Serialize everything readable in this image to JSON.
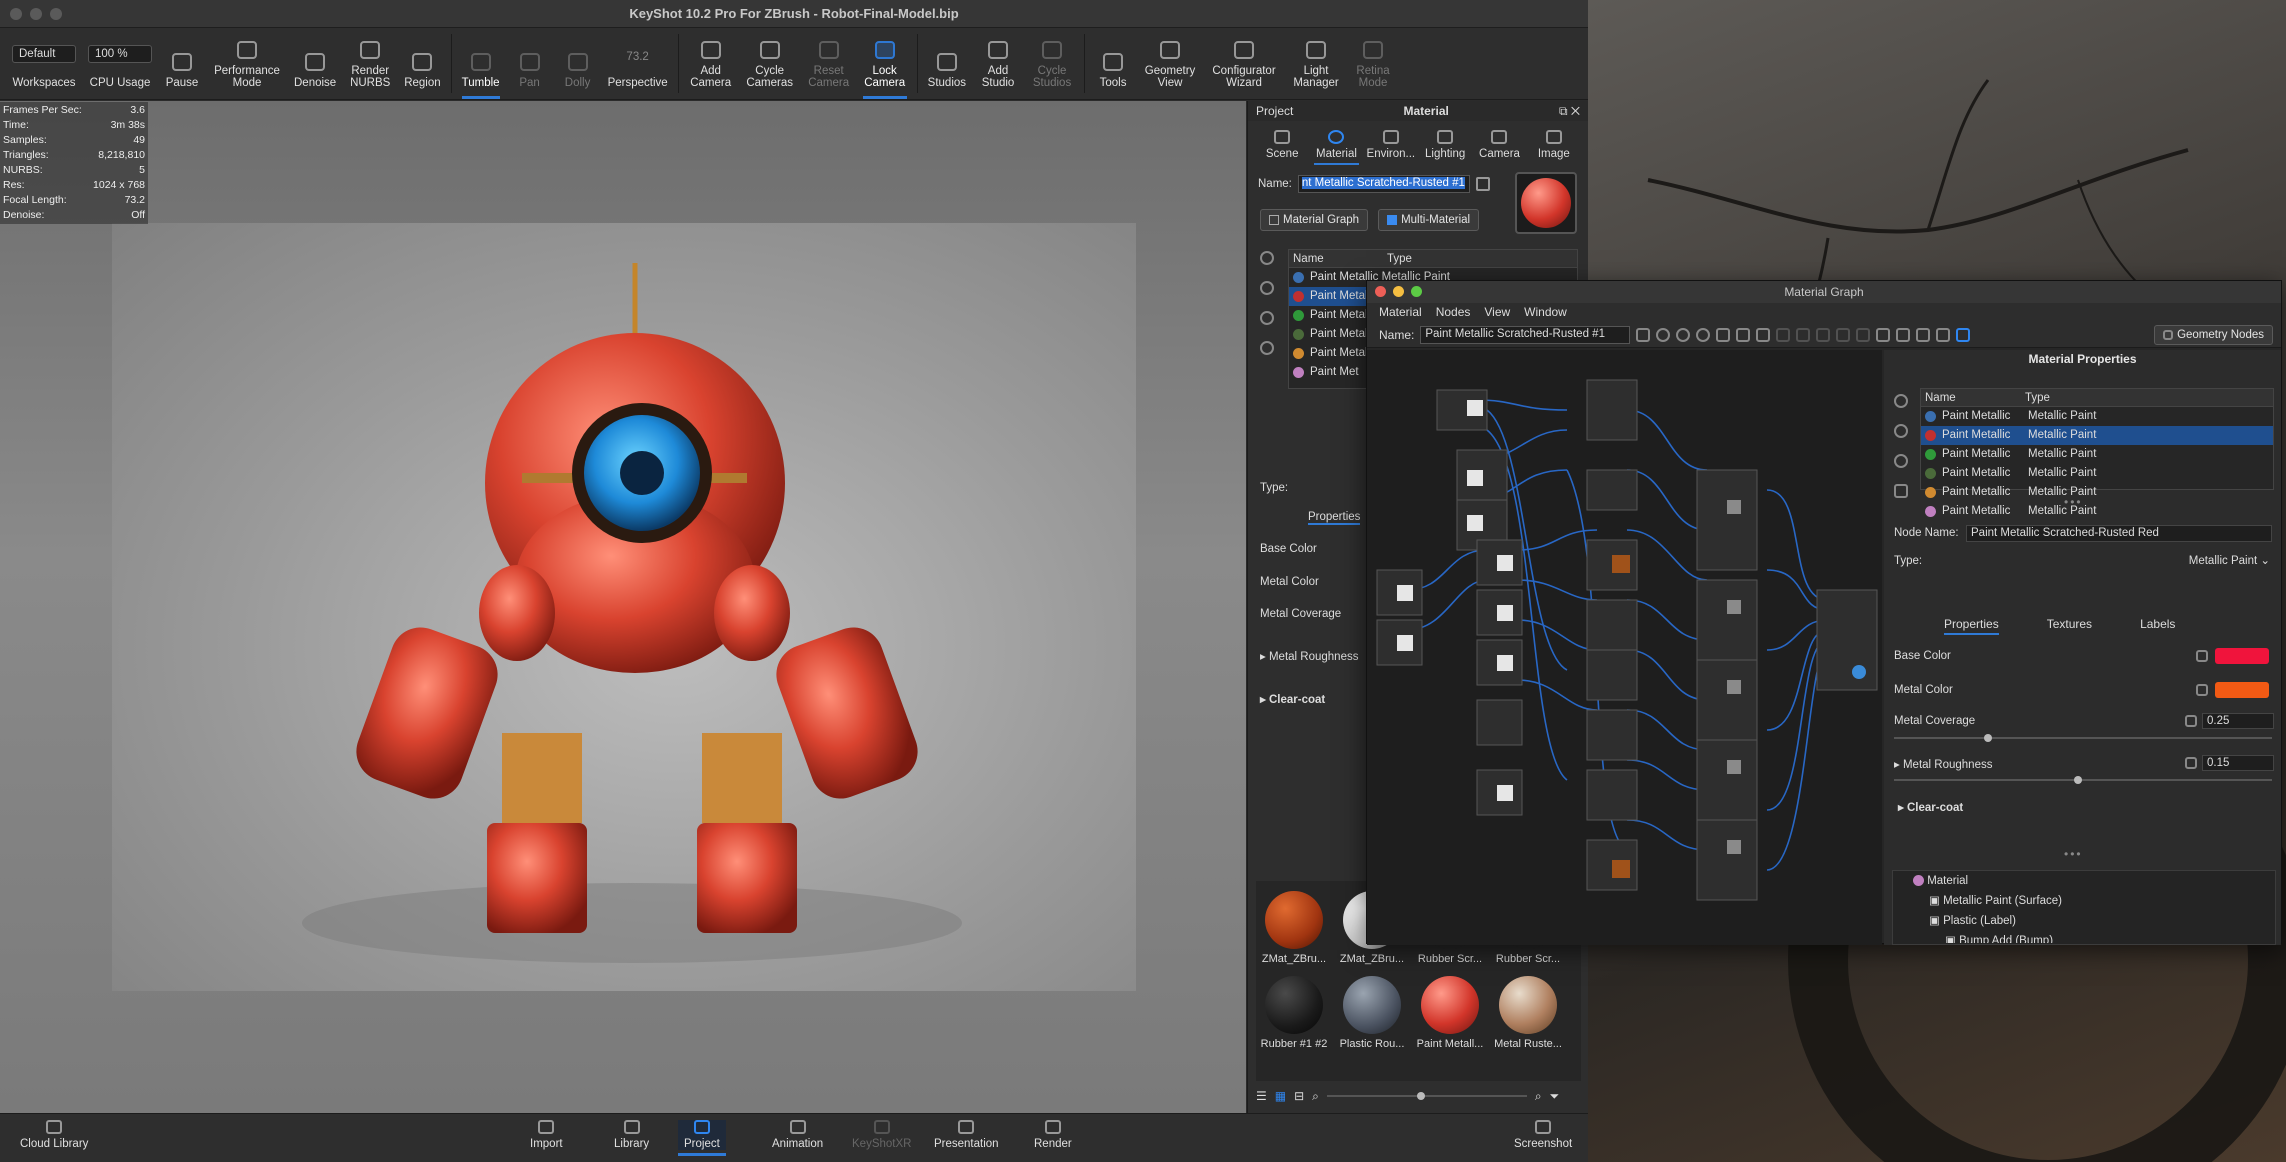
{
  "window": {
    "title": "KeyShot 10.2 Pro For ZBrush - Robot-Final-Model.bip"
  },
  "toolbar": {
    "workspace_value": "Default",
    "workspaces_label": "Workspaces",
    "cpu_value": "100 %",
    "cpu_label": "CPU Usage",
    "pause_label": "Pause",
    "performance_label": "Performance Mode",
    "denoise_label": "Denoise",
    "render_nurbs_label": "Render NURBS",
    "region_label": "Region",
    "tumble_label": "Tumble",
    "pan_label": "Pan",
    "dolly_label": "Dolly",
    "fov_value": "73.2",
    "perspective_label": "Perspective",
    "add_camera_label": "Add Camera",
    "cycle_cameras_label": "Cycle Cameras",
    "reset_camera_label": "Reset Camera",
    "lock_camera_label": "Lock Camera",
    "studios_label": "Studios",
    "add_studio_label": "Add Studio",
    "cycle_studios_label": "Cycle Studios",
    "tools_label": "Tools",
    "geometry_view_label": "Geometry View",
    "configurator_label": "Configurator Wizard",
    "light_manager_label": "Light Manager",
    "retina_label": "Retina Mode"
  },
  "stats": [
    {
      "k": "Frames Per Sec:",
      "v": "3.6"
    },
    {
      "k": "Time:",
      "v": "3m 38s"
    },
    {
      "k": "Samples:",
      "v": "49"
    },
    {
      "k": "Triangles:",
      "v": "8,218,810"
    },
    {
      "k": "NURBS:",
      "v": "5"
    },
    {
      "k": "Res:",
      "v": "1024 x 768"
    },
    {
      "k": "Focal Length:",
      "v": "73.2"
    },
    {
      "k": "Denoise:",
      "v": "Off"
    }
  ],
  "panel": {
    "tab_project": "Project",
    "tab_material": "Material",
    "tabs": [
      "Scene",
      "Material",
      "Environ...",
      "Lighting",
      "Camera",
      "Image"
    ],
    "name_label": "Name:",
    "name_value": "nt Metallic Scratched-Rusted #1",
    "material_graph_btn": "Material Graph",
    "multi_material_btn": "Multi-Material",
    "list_col_name": "Name",
    "list_col_type": "Type",
    "list_rows": [
      "Paint Metallic Metallic Paint",
      "Paint Metal",
      "Paint Metal",
      "Paint Metal",
      "Paint Metal",
      "Paint Met"
    ],
    "type_label": "Type:",
    "properties_tab": "Properties",
    "base_color": "Base Color",
    "metal_color": "Metal Color",
    "metal_coverage": "Metal Coverage",
    "metal_roughness": "Metal Roughness",
    "clear_coat": "Clear-coat",
    "swatches": [
      "ZMat_ZBru...",
      "ZMat_ZBru...",
      "Rubber Scr...",
      "Rubber Scr...",
      "Rubber #1 #2",
      "Plastic Rou...",
      "Paint Metall...",
      "Metal Ruste..."
    ]
  },
  "bottombar": {
    "cloud_library": "Cloud Library",
    "import": "Import",
    "library": "Library",
    "project": "Project",
    "animation": "Animation",
    "keyshotxr": "KeyShotXR",
    "presentation": "Presentation",
    "render": "Render",
    "screenshot": "Screenshot"
  },
  "material_graph": {
    "title": "Material Graph",
    "menu": [
      "Material",
      "Nodes",
      "View",
      "Window"
    ],
    "name_label": "Name:",
    "name_value": "Paint Metallic Scratched-Rusted #1",
    "geometry_nodes": "Geometry Nodes",
    "props_title": "Material Properties",
    "col_name": "Name",
    "col_type": "Type",
    "rows": [
      {
        "name": "Paint Metallic",
        "type": "Metallic Paint"
      },
      {
        "name": "Paint Metallic",
        "type": "Metallic Paint"
      },
      {
        "name": "Paint Metallic",
        "type": "Metallic Paint"
      },
      {
        "name": "Paint Metallic",
        "type": "Metallic Paint"
      },
      {
        "name": "Paint Metallic",
        "type": "Metallic Paint"
      },
      {
        "name": "Paint Metallic",
        "type": "Metallic Paint"
      }
    ],
    "node_name_label": "Node Name:",
    "node_name_value": "Paint Metallic Scratched-Rusted Red",
    "type_label": "Type:",
    "type_value": "Metallic Paint",
    "tabs": [
      "Properties",
      "Textures",
      "Labels"
    ],
    "base_color": "Base Color",
    "metal_color": "Metal Color",
    "metal_coverage": "Metal Coverage",
    "metal_coverage_value": "0.25",
    "metal_roughness": "Metal Roughness",
    "metal_roughness_value": "0.15",
    "clear_coat": "Clear-coat",
    "tree": [
      "Material",
      "Metallic Paint (Surface)",
      "Plastic (Label)",
      "Bump Add (Bump)"
    ]
  },
  "colors": {
    "accent": "#2f7ad6",
    "base_color": "#f0143c",
    "metal_color": "#f25a14"
  }
}
